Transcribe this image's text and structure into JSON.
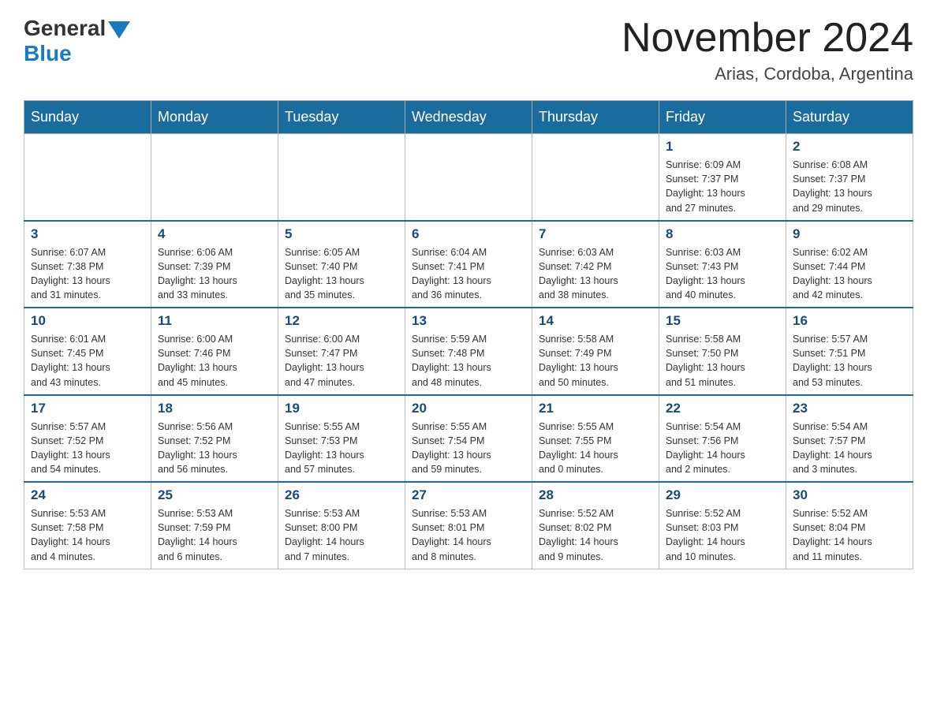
{
  "header": {
    "logo_general": "General",
    "logo_blue": "Blue",
    "month_title": "November 2024",
    "location": "Arias, Cordoba, Argentina"
  },
  "days_of_week": [
    "Sunday",
    "Monday",
    "Tuesday",
    "Wednesday",
    "Thursday",
    "Friday",
    "Saturday"
  ],
  "weeks": [
    [
      {
        "day": "",
        "info": ""
      },
      {
        "day": "",
        "info": ""
      },
      {
        "day": "",
        "info": ""
      },
      {
        "day": "",
        "info": ""
      },
      {
        "day": "",
        "info": ""
      },
      {
        "day": "1",
        "info": "Sunrise: 6:09 AM\nSunset: 7:37 PM\nDaylight: 13 hours\nand 27 minutes."
      },
      {
        "day": "2",
        "info": "Sunrise: 6:08 AM\nSunset: 7:37 PM\nDaylight: 13 hours\nand 29 minutes."
      }
    ],
    [
      {
        "day": "3",
        "info": "Sunrise: 6:07 AM\nSunset: 7:38 PM\nDaylight: 13 hours\nand 31 minutes."
      },
      {
        "day": "4",
        "info": "Sunrise: 6:06 AM\nSunset: 7:39 PM\nDaylight: 13 hours\nand 33 minutes."
      },
      {
        "day": "5",
        "info": "Sunrise: 6:05 AM\nSunset: 7:40 PM\nDaylight: 13 hours\nand 35 minutes."
      },
      {
        "day": "6",
        "info": "Sunrise: 6:04 AM\nSunset: 7:41 PM\nDaylight: 13 hours\nand 36 minutes."
      },
      {
        "day": "7",
        "info": "Sunrise: 6:03 AM\nSunset: 7:42 PM\nDaylight: 13 hours\nand 38 minutes."
      },
      {
        "day": "8",
        "info": "Sunrise: 6:03 AM\nSunset: 7:43 PM\nDaylight: 13 hours\nand 40 minutes."
      },
      {
        "day": "9",
        "info": "Sunrise: 6:02 AM\nSunset: 7:44 PM\nDaylight: 13 hours\nand 42 minutes."
      }
    ],
    [
      {
        "day": "10",
        "info": "Sunrise: 6:01 AM\nSunset: 7:45 PM\nDaylight: 13 hours\nand 43 minutes."
      },
      {
        "day": "11",
        "info": "Sunrise: 6:00 AM\nSunset: 7:46 PM\nDaylight: 13 hours\nand 45 minutes."
      },
      {
        "day": "12",
        "info": "Sunrise: 6:00 AM\nSunset: 7:47 PM\nDaylight: 13 hours\nand 47 minutes."
      },
      {
        "day": "13",
        "info": "Sunrise: 5:59 AM\nSunset: 7:48 PM\nDaylight: 13 hours\nand 48 minutes."
      },
      {
        "day": "14",
        "info": "Sunrise: 5:58 AM\nSunset: 7:49 PM\nDaylight: 13 hours\nand 50 minutes."
      },
      {
        "day": "15",
        "info": "Sunrise: 5:58 AM\nSunset: 7:50 PM\nDaylight: 13 hours\nand 51 minutes."
      },
      {
        "day": "16",
        "info": "Sunrise: 5:57 AM\nSunset: 7:51 PM\nDaylight: 13 hours\nand 53 minutes."
      }
    ],
    [
      {
        "day": "17",
        "info": "Sunrise: 5:57 AM\nSunset: 7:52 PM\nDaylight: 13 hours\nand 54 minutes."
      },
      {
        "day": "18",
        "info": "Sunrise: 5:56 AM\nSunset: 7:52 PM\nDaylight: 13 hours\nand 56 minutes."
      },
      {
        "day": "19",
        "info": "Sunrise: 5:55 AM\nSunset: 7:53 PM\nDaylight: 13 hours\nand 57 minutes."
      },
      {
        "day": "20",
        "info": "Sunrise: 5:55 AM\nSunset: 7:54 PM\nDaylight: 13 hours\nand 59 minutes."
      },
      {
        "day": "21",
        "info": "Sunrise: 5:55 AM\nSunset: 7:55 PM\nDaylight: 14 hours\nand 0 minutes."
      },
      {
        "day": "22",
        "info": "Sunrise: 5:54 AM\nSunset: 7:56 PM\nDaylight: 14 hours\nand 2 minutes."
      },
      {
        "day": "23",
        "info": "Sunrise: 5:54 AM\nSunset: 7:57 PM\nDaylight: 14 hours\nand 3 minutes."
      }
    ],
    [
      {
        "day": "24",
        "info": "Sunrise: 5:53 AM\nSunset: 7:58 PM\nDaylight: 14 hours\nand 4 minutes."
      },
      {
        "day": "25",
        "info": "Sunrise: 5:53 AM\nSunset: 7:59 PM\nDaylight: 14 hours\nand 6 minutes."
      },
      {
        "day": "26",
        "info": "Sunrise: 5:53 AM\nSunset: 8:00 PM\nDaylight: 14 hours\nand 7 minutes."
      },
      {
        "day": "27",
        "info": "Sunrise: 5:53 AM\nSunset: 8:01 PM\nDaylight: 14 hours\nand 8 minutes."
      },
      {
        "day": "28",
        "info": "Sunrise: 5:52 AM\nSunset: 8:02 PM\nDaylight: 14 hours\nand 9 minutes."
      },
      {
        "day": "29",
        "info": "Sunrise: 5:52 AM\nSunset: 8:03 PM\nDaylight: 14 hours\nand 10 minutes."
      },
      {
        "day": "30",
        "info": "Sunrise: 5:52 AM\nSunset: 8:04 PM\nDaylight: 14 hours\nand 11 minutes."
      }
    ]
  ]
}
